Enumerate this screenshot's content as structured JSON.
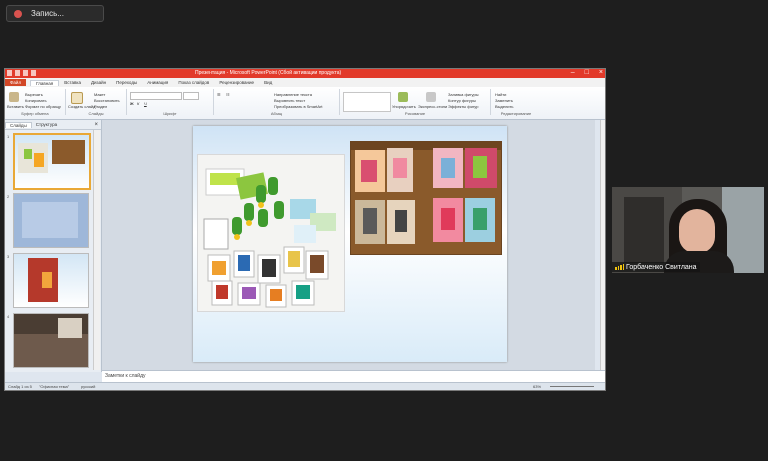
{
  "recording": {
    "label": "Запись..."
  },
  "powerpoint": {
    "title": "Презентация - Microsoft PowerPoint (Сбой активации продукта)",
    "tabs": [
      "Главная",
      "Вставка",
      "Дизайн",
      "Переходы",
      "Анимация",
      "Показ слайдов",
      "Рецензирование",
      "Вид"
    ],
    "file_tab": "Файл",
    "active_tab": "Главная",
    "ribbon": {
      "clipboard": {
        "label": "Буфер обмена",
        "paste": "Вставить",
        "cut": "Вырезать",
        "copy": "Копировать",
        "format": "Формат по образцу"
      },
      "slides": {
        "label": "Слайды",
        "new": "Создать слайд",
        "layout": "Макет",
        "reset": "Восстановить",
        "section": "Раздел"
      },
      "font": {
        "label": "Шрифт"
      },
      "paragraph": {
        "label": "Абзац",
        "text_dir": "Направление текста",
        "align": "Выровнять текст",
        "smartart": "Преобразовать в SmartArt"
      },
      "drawing": {
        "label": "Рисование",
        "arrange": "Упорядочить",
        "quick_styles": "Экспресс-стили",
        "fill": "Заливка фигуры",
        "outline": "Контур фигуры",
        "effects": "Эффекты фигур"
      },
      "editing": {
        "label": "Редактирование",
        "find": "Найти",
        "replace": "Заменить",
        "select": "Выделить"
      }
    },
    "left_panel": {
      "tab_slides": "Слайды",
      "tab_outline": "Структура",
      "slide_numbers": [
        "1",
        "2",
        "3",
        "4"
      ]
    },
    "notes_placeholder": "Заметки к слайду",
    "status": {
      "slide": "Слайд 1 из 5",
      "theme": "\"Офисная тема\"",
      "language": "русский",
      "zoom": "63%"
    }
  },
  "webcam": {
    "participant": "Горбаченко Свитлана"
  },
  "colors": {
    "accent": "#d24726",
    "title_bar": "#e23a2a",
    "recording_dot": "#d9534f",
    "signal": "#f1c40f"
  }
}
